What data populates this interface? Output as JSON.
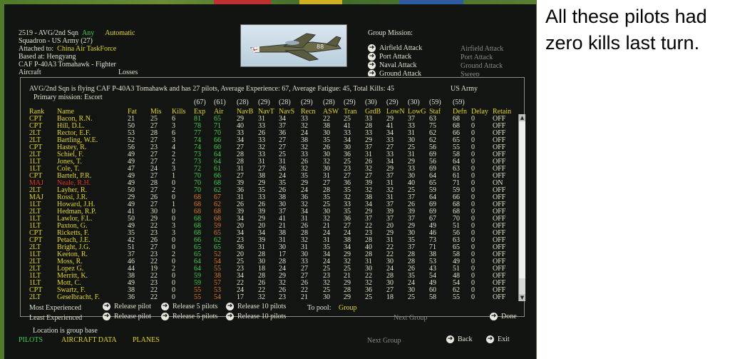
{
  "header": {
    "unit_line": "2519 - AVG/2nd Sqn",
    "any": "Any",
    "automatic": "Automatic",
    "squadron": "Squadron - US Army (27)",
    "attached_label": "Attached to:",
    "attached_value": "China Air TaskForce",
    "based": "Based at: Hengyang",
    "aircraft_type": "CAF P-40A3 Tomahawk - Fighter",
    "aircraft_label": "Aircraft",
    "losses_label": "Losses"
  },
  "plane_number": "88",
  "group_mission": {
    "title": "Group Mission:",
    "items": [
      {
        "label": "Airfield Attack",
        "value": "Airfield Attack"
      },
      {
        "label": "Port Attack",
        "value": "Port Attack"
      },
      {
        "label": "Naval Attack",
        "value": "Ground Attack"
      },
      {
        "label": "Ground Attack",
        "value": "Sweep"
      }
    ]
  },
  "panel": {
    "summary": "AVG/2nd Sqn is flying CAF P-40A3 Tomahawk and has 27 pilots,  Average Experience: 67, Average Fatigue: 45, Total Kills: 45",
    "service": "US Army",
    "primary": "Primary mission: Escort",
    "columns": [
      "Rank",
      "Name",
      "Fat",
      "Mis",
      "Kills",
      "Exp",
      "Air",
      "NavB",
      "NavT",
      "NavS",
      "Recn",
      "ASW",
      "Tran",
      "GrdB",
      "LowN",
      "LowG",
      "Staf",
      "Defn",
      "Delay",
      "Retain"
    ],
    "averages": [
      "(67)",
      "(61)",
      "(28)",
      "(29)",
      "(28)",
      "(29)",
      "(28)",
      "(29)",
      "(30)",
      "(29)",
      "(30)",
      "(59)",
      "(59)"
    ],
    "pilots": [
      [
        "CPT",
        "Bacon, R.N.",
        "21",
        "25",
        "6",
        "81",
        "65",
        "29",
        "31",
        "34",
        "33",
        "22",
        "25",
        "33",
        "29",
        "37",
        "63",
        "68",
        "0",
        "OFF"
      ],
      [
        "CPT",
        "Hill, D.L.",
        "50",
        "27",
        "3",
        "78",
        "71",
        "40",
        "33",
        "37",
        "32",
        "38",
        "41",
        "28",
        "41",
        "33",
        "75",
        "68",
        "0",
        "OFF"
      ],
      [
        "2LT",
        "Rector, E.F.",
        "53",
        "28",
        "6",
        "77",
        "70",
        "33",
        "26",
        "36",
        "24",
        "30",
        "33",
        "33",
        "34",
        "31",
        "62",
        "66",
        "0",
        "OFF"
      ],
      [
        "2LT",
        "Bartling, W.E.",
        "52",
        "27",
        "3",
        "74",
        "66",
        "34",
        "33",
        "27",
        "38",
        "35",
        "34",
        "29",
        "33",
        "30",
        "62",
        "65",
        "0",
        "OFF"
      ],
      [
        "CPT",
        "Hastey, R.",
        "56",
        "23",
        "4",
        "74",
        "60",
        "27",
        "32",
        "27",
        "32",
        "26",
        "30",
        "37",
        "27",
        "25",
        "56",
        "55",
        "0",
        "OFF"
      ],
      [
        "2LT",
        "Schiel, F.",
        "49",
        "27",
        "2",
        "73",
        "64",
        "28",
        "33",
        "25",
        "33",
        "30",
        "36",
        "31",
        "33",
        "31",
        "69",
        "58",
        "0",
        "OFF"
      ],
      [
        "1LT",
        "Jones, T.",
        "49",
        "27",
        "2",
        "73",
        "64",
        "28",
        "31",
        "31",
        "26",
        "32",
        "25",
        "26",
        "34",
        "29",
        "56",
        "64",
        "0",
        "OFF"
      ],
      [
        "1LT",
        "Cole, T.",
        "47",
        "24",
        "3",
        "72",
        "61",
        "31",
        "27",
        "26",
        "32",
        "30",
        "23",
        "32",
        "29",
        "33",
        "69",
        "63",
        "0",
        "OFF"
      ],
      [
        "CPT",
        "Bartelt, P.R.",
        "49",
        "27",
        "1",
        "70",
        "66",
        "27",
        "38",
        "24",
        "35",
        "31",
        "27",
        "27",
        "37",
        "30",
        "64",
        "61",
        "0",
        "OFF"
      ],
      [
        "MAJ",
        "Neale, R.H.",
        "49",
        "28",
        "0",
        "70",
        "68",
        "39",
        "29",
        "35",
        "29",
        "27",
        "36",
        "39",
        "31",
        "40",
        "65",
        "71",
        "0",
        "ON"
      ],
      [
        "2LT",
        "Layher, R.",
        "50",
        "27",
        "2",
        "70",
        "62",
        "36",
        "35",
        "26",
        "24",
        "28",
        "35",
        "32",
        "32",
        "25",
        "59",
        "59",
        "0",
        "OFF"
      ],
      [
        "MAJ",
        "Rossi, J.R.",
        "29",
        "26",
        "0",
        "68",
        "67",
        "31",
        "33",
        "38",
        "36",
        "35",
        "32",
        "38",
        "31",
        "37",
        "64",
        "66",
        "0",
        "OFF"
      ],
      [
        "1LT",
        "Howard, J.H.",
        "49",
        "27",
        "1",
        "68",
        "62",
        "26",
        "26",
        "30",
        "32",
        "25",
        "33",
        "34",
        "37",
        "26",
        "69",
        "68",
        "0",
        "OFF"
      ],
      [
        "2LT",
        "Hedman, R.P.",
        "41",
        "30",
        "0",
        "68",
        "68",
        "39",
        "39",
        "37",
        "34",
        "30",
        "35",
        "29",
        "39",
        "39",
        "69",
        "68",
        "0",
        "OFF"
      ],
      [
        "1LT",
        "Lawlor, F.L.",
        "50",
        "29",
        "0",
        "68",
        "68",
        "34",
        "29",
        "41",
        "31",
        "32",
        "36",
        "37",
        "37",
        "37",
        "67",
        "70",
        "0",
        "OFF"
      ],
      [
        "1LT",
        "Paxton, G.",
        "49",
        "22",
        "3",
        "68",
        "59",
        "20",
        "20",
        "21",
        "26",
        "21",
        "27",
        "22",
        "20",
        "29",
        "49",
        "51",
        "0",
        "OFF"
      ],
      [
        "CPT",
        "Ricketts, F.",
        "35",
        "23",
        "3",
        "68",
        "65",
        "34",
        "34",
        "38",
        "28",
        "24",
        "24",
        "23",
        "29",
        "30",
        "46",
        "56",
        "0",
        "OFF"
      ],
      [
        "CPT",
        "Petach, J.E.",
        "42",
        "26",
        "0",
        "66",
        "62",
        "23",
        "39",
        "31",
        "32",
        "31",
        "38",
        "28",
        "31",
        "35",
        "73",
        "63",
        "0",
        "OFF"
      ],
      [
        "2LT",
        "Bright, J.G.",
        "51",
        "27",
        "0",
        "65",
        "65",
        "36",
        "31",
        "30",
        "31",
        "35",
        "34",
        "40",
        "22",
        "37",
        "71",
        "65",
        "0",
        "OFF"
      ],
      [
        "1LT",
        "Keeton, R.",
        "37",
        "23",
        "2",
        "65",
        "52",
        "20",
        "28",
        "17",
        "30",
        "34",
        "29",
        "28",
        "22",
        "28",
        "38",
        "58",
        "0",
        "OFF"
      ],
      [
        "2LT",
        "Moss, R.",
        "46",
        "22",
        "0",
        "64",
        "54",
        "25",
        "30",
        "28",
        "33",
        "24",
        "32",
        "31",
        "30",
        "28",
        "53",
        "49",
        "0",
        "OFF"
      ],
      [
        "2LT",
        "Lopez G.",
        "44",
        "19",
        "2",
        "64",
        "55",
        "23",
        "18",
        "24",
        "27",
        "25",
        "25",
        "30",
        "24",
        "26",
        "43",
        "51",
        "0",
        "OFF"
      ],
      [
        "1LT",
        "Merritt, K.",
        "38",
        "22",
        "0",
        "59",
        "38",
        "34",
        "28",
        "29",
        "27",
        "23",
        "21",
        "22",
        "28",
        "35",
        "54",
        "48",
        "0",
        "OFF"
      ],
      [
        "1LT",
        "Mott, C.",
        "49",
        "23",
        "0",
        "59",
        "57",
        "22",
        "26",
        "32",
        "26",
        "32",
        "29",
        "32",
        "30",
        "24",
        "49",
        "54",
        "0",
        "OFF"
      ],
      [
        "CPT",
        "Swartz, F.",
        "38",
        "22",
        "0",
        "55",
        "53",
        "24",
        "22",
        "26",
        "22",
        "25",
        "28",
        "36",
        "27",
        "30",
        "60",
        "62",
        "0",
        "OFF"
      ],
      [
        "2LT",
        "Geselbracht, F.",
        "36",
        "22",
        "0",
        "55",
        "54",
        "17",
        "32",
        "23",
        "21",
        "30",
        "29",
        "25",
        "18",
        "25",
        "58",
        "55",
        "0",
        "OFF"
      ]
    ],
    "bottom": {
      "most": "Most Experienced",
      "least": "Least Experienced",
      "release_pilot": "Release pilot",
      "release_5": "Release 5 pilots",
      "release_10": "Release 10 pilots",
      "to_pool": "To pool:",
      "group": "Group",
      "next_group": "Next Group",
      "done": "Done"
    }
  },
  "footer": {
    "location": "Location is group base",
    "pilots": "PILOTS",
    "aircraft_data": "AIRCRAFT DATA",
    "planes": "PLANES",
    "next_group": "Next Group",
    "back": "Back",
    "exit": "Exit"
  },
  "annotation": "All these pilots had zero kills last turn.",
  "colors": {
    "yellow": "#e6d800",
    "green": "#3fd04a",
    "orange": "#e8781c",
    "red": "#e83020",
    "background": "#111410"
  }
}
